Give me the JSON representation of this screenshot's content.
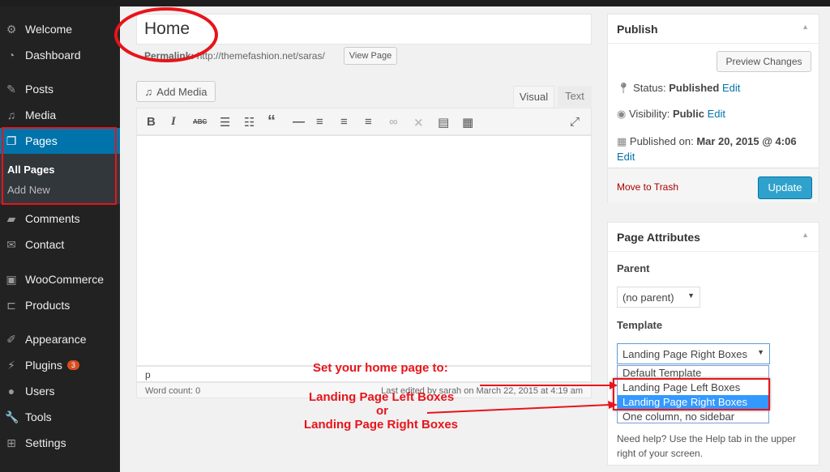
{
  "sidebar": {
    "items": [
      {
        "label": "Welcome",
        "icon": "gear-icon"
      },
      {
        "label": "Dashboard",
        "icon": "dashboard-icon"
      },
      {
        "label": "Posts",
        "icon": "pin-icon"
      },
      {
        "label": "Media",
        "icon": "media-icon"
      },
      {
        "label": "Pages",
        "icon": "pages-icon"
      },
      {
        "label": "Comments",
        "icon": "comment-icon"
      },
      {
        "label": "Contact",
        "icon": "mail-icon"
      },
      {
        "label": "WooCommerce",
        "icon": "woo-icon"
      },
      {
        "label": "Products",
        "icon": "cart-icon"
      },
      {
        "label": "Appearance",
        "icon": "brush-icon"
      },
      {
        "label": "Plugins",
        "icon": "plugin-icon",
        "badge": "3"
      },
      {
        "label": "Users",
        "icon": "user-icon"
      },
      {
        "label": "Tools",
        "icon": "wrench-icon"
      },
      {
        "label": "Settings",
        "icon": "settings-icon"
      }
    ],
    "submenu": [
      "All Pages",
      "Add New"
    ]
  },
  "editor": {
    "title": "Home",
    "permalink_label": "Permalink:",
    "permalink_url": "http://themefashion.net/saras/",
    "view_page": "View Page",
    "add_media": "Add Media",
    "tab_visual": "Visual",
    "tab_text": "Text",
    "path": "p",
    "word_count": "Word count: 0",
    "last_edited": "Last edited by sarah on March 22, 2015 at 4:19 am"
  },
  "publish": {
    "title": "Publish",
    "preview": "Preview Changes",
    "status_label": "Status:",
    "status": "Published",
    "edit": "Edit",
    "visibility_label": "Visibility:",
    "visibility": "Public",
    "published_label": "Published on:",
    "published_date": "Mar 20, 2015 @ 4:06",
    "trash": "Move to Trash",
    "update": "Update"
  },
  "attributes": {
    "title": "Page Attributes",
    "parent_label": "Parent",
    "parent_value": "(no parent)",
    "template_label": "Template",
    "template_value": "Landing Page Right Boxes",
    "options": [
      "Default Template",
      "Landing Page Left Boxes",
      "Landing Page Right Boxes",
      "One column, no sidebar"
    ],
    "help": "Need help? Use the Help tab in the upper right of your screen."
  },
  "annotation": {
    "line1": "Set your home page to:",
    "line2": "Landing Page Left Boxes",
    "line3": "or",
    "line4": "Landing Page Right Boxes"
  },
  "colors": {
    "accent": "#0073aa",
    "annotation": "#e8141b",
    "highlight": "#3399ff"
  }
}
